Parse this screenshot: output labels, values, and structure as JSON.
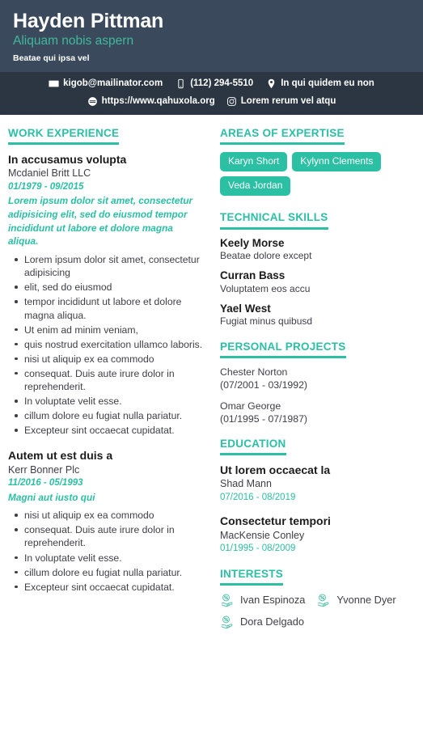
{
  "header": {
    "full_name": "Hayden Pittman",
    "headline": "Aliquam nobis aspern",
    "sub_headline": "Beatae qui ipsa vel",
    "bg_top_color": "#3a4a5c",
    "bg_bottom_color": "#2b3642",
    "accent_color": "#2bbfa4",
    "contacts_row1": [
      {
        "icon": "envelope-icon",
        "text": "kigob@mailinator.com"
      },
      {
        "icon": "phone-icon",
        "text": "(112) 294-5510"
      },
      {
        "icon": "map-pin-icon",
        "text": "In qui quidem eu non"
      }
    ],
    "contacts_row2": [
      {
        "icon": "globe-icon",
        "text": "https://www.qahuxola.org"
      },
      {
        "icon": "instagram-icon",
        "text": "Lorem rerum vel atqu"
      }
    ]
  },
  "work_experience": {
    "title": "WORK EXPERIENCE",
    "entries": [
      {
        "job_title": "In accusamus volupta",
        "company": "Mcdaniel Britt LLC",
        "dates": "01/1979 - 09/2015",
        "description": "Lorem ipsum dolor sit amet, consectetur adipisicing elit, sed do eiusmod tempor incididunt ut labore et dolore magna aliqua.",
        "bullets": [
          "Lorem ipsum dolor sit amet, consectetur adipisicing",
          "elit, sed do eiusmod",
          "tempor incididunt ut labore et dolore magna aliqua.",
          "Ut enim ad minim veniam,",
          "quis nostrud exercitation ullamco laboris.",
          "nisi ut aliquip ex ea commodo",
          "consequat. Duis aute irure dolor in reprehenderit.",
          "In voluptate velit esse.",
          "cillum dolore eu fugiat nulla pariatur.",
          "Excepteur sint occaecat cupidatat."
        ]
      },
      {
        "job_title": "Autem ut est duis a",
        "company": "Kerr Bonner Plc",
        "dates": "11/2016 - 05/1993",
        "description": "Magni aut iusto qui",
        "bullets": [
          "nisi ut aliquip ex ea commodo",
          "consequat. Duis aute irure dolor in reprehenderit.",
          "In voluptate velit esse.",
          "cillum dolore eu fugiat nulla pariatur.",
          "Excepteur sint occaecat cupidatat."
        ]
      }
    ]
  },
  "areas_of_expertise": {
    "title": "AREAS OF EXPERTISE",
    "items": [
      "Karyn Short",
      "Kylynn Clements",
      "Veda Jordan"
    ]
  },
  "technical_skills": {
    "title": "TECHNICAL SKILLS",
    "items": [
      {
        "name": "Keely Morse",
        "detail": "Beatae dolore except"
      },
      {
        "name": "Curran Bass",
        "detail": "Voluptatem eos accu"
      },
      {
        "name": "Yael West",
        "detail": "Fugiat minus quibusd"
      }
    ]
  },
  "personal_projects": {
    "title": "PERSONAL PROJECTS",
    "items": [
      {
        "name": "Chester Norton",
        "dates": "(07/2001 - 03/1992)"
      },
      {
        "name": "Omar George",
        "dates": "(01/1995 - 07/1987)"
      }
    ]
  },
  "education": {
    "title": "EDUCATION",
    "items": [
      {
        "degree": "Ut lorem occaecat la",
        "school": "Shad Mann",
        "dates": "07/2016 - 08/2019"
      },
      {
        "degree": "Consectetur tempori",
        "school": "MacKensie Conley",
        "dates": "01/1995 - 08/2009"
      }
    ]
  },
  "interests": {
    "title": "INTERESTS",
    "icon": "hand-percent-icon",
    "items": [
      "Ivan Espinoza",
      "Yvonne Dyer",
      "Dora Delgado"
    ]
  }
}
